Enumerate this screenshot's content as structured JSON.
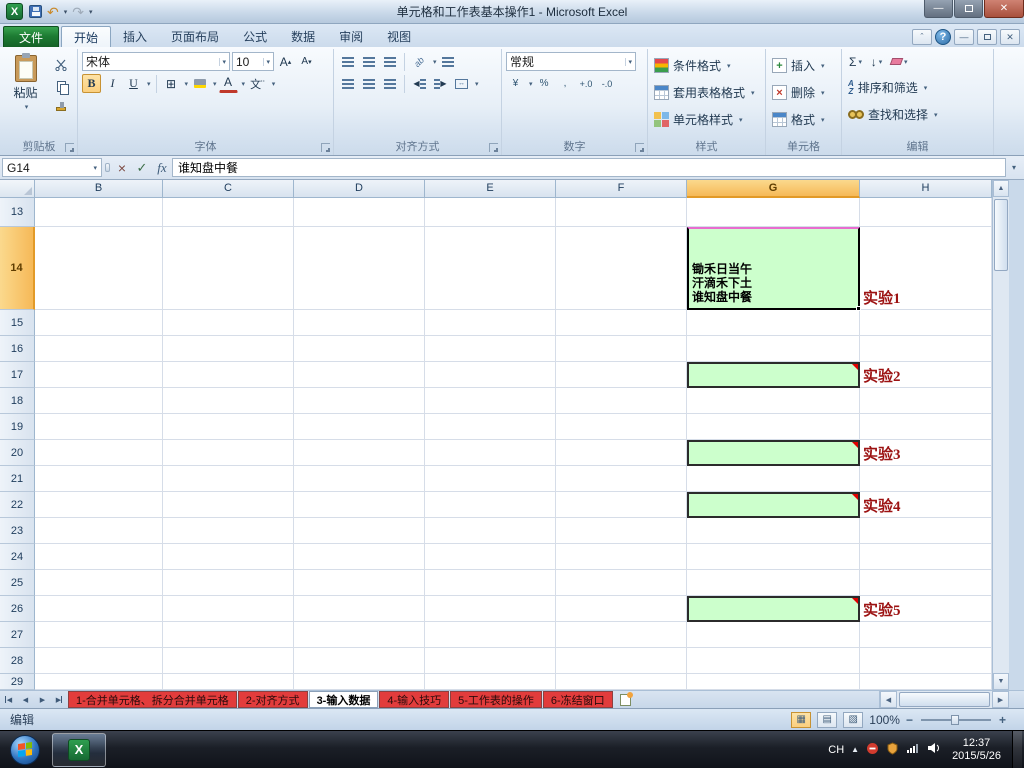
{
  "colors": {
    "cell_fill_green": "#ccffcc",
    "label_red": "#9c1212",
    "sheet_tab_red": "#e23c3c",
    "selected_header_orange": "#f6b958",
    "file_tab_green": "#1f7c33"
  },
  "titlebar": {
    "title": "单元格和工作表基本操作1 - Microsoft Excel"
  },
  "ribbon_tabs": {
    "file": "文件",
    "active": "开始",
    "tabs": [
      "开始",
      "插入",
      "页面布局",
      "公式",
      "数据",
      "审阅",
      "视图"
    ]
  },
  "ribbon": {
    "clipboard": {
      "label": "剪贴板",
      "paste": "粘贴"
    },
    "font": {
      "label": "字体",
      "name": "宋体",
      "size": "10",
      "bold": "B",
      "italic": "I",
      "underline": "U"
    },
    "alignment": {
      "label": "对齐方式"
    },
    "number": {
      "label": "数字",
      "format": "常规"
    },
    "styles": {
      "label": "样式",
      "conditional": "条件格式",
      "format_table": "套用表格格式",
      "cell_styles": "单元格样式"
    },
    "cells": {
      "label": "单元格",
      "insert": "插入",
      "delete": "删除",
      "format": "格式"
    },
    "editing": {
      "label": "编辑",
      "sort": "排序和筛选",
      "find": "查找和选择"
    }
  },
  "formula_bar": {
    "name_box": "G14",
    "value": "谁知盘中餐",
    "fx": "fx"
  },
  "grid": {
    "columns": [
      "B",
      "C",
      "D",
      "E",
      "F",
      "G",
      "H"
    ],
    "rows": [
      "13",
      "14",
      "15",
      "16",
      "17",
      "18",
      "19",
      "20",
      "21",
      "22",
      "23",
      "24",
      "25",
      "26",
      "27",
      "28",
      "29"
    ],
    "selected_column": "G",
    "selected_row": "14",
    "selected_cell": {
      "ref": "G14",
      "lines": [
        "锄禾日当午",
        "汗滴禾下土",
        "谁知盘中餐"
      ]
    },
    "comment_cells": [
      "G17",
      "G20",
      "G22",
      "G26"
    ],
    "labels": [
      {
        "ref": "H14",
        "text": "实验1"
      },
      {
        "ref": "H17",
        "text": "实验2"
      },
      {
        "ref": "H20",
        "text": "实验3"
      },
      {
        "ref": "H22",
        "text": "实验4"
      },
      {
        "ref": "H26",
        "text": "实验5"
      }
    ]
  },
  "sheet_tabs": [
    {
      "label": "1-合并单元格、拆分合并单元格",
      "color": "red",
      "active": false
    },
    {
      "label": "2-对齐方式",
      "color": "red",
      "active": false
    },
    {
      "label": "3-输入数据",
      "color": "white",
      "active": true
    },
    {
      "label": "4-输入技巧",
      "color": "red",
      "active": false
    },
    {
      "label": "5-工作表的操作",
      "color": "red",
      "active": false
    },
    {
      "label": "6-冻结窗口",
      "color": "red",
      "active": false
    }
  ],
  "status_bar": {
    "mode": "编辑",
    "zoom": "100%"
  },
  "taskbar": {
    "language": "CH",
    "time": "12:37",
    "date": "2015/5/26"
  }
}
